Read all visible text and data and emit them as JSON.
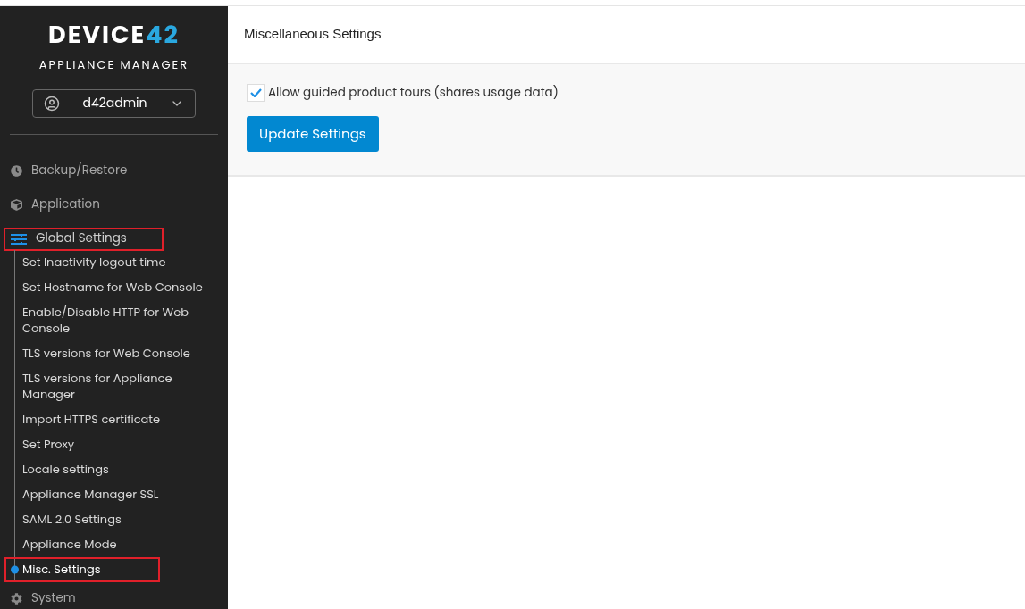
{
  "logo": {
    "name": "DEVICE",
    "number": "42",
    "subtitle": "APPLIANCE MANAGER"
  },
  "user_menu": {
    "label": "d42admin"
  },
  "nav": [
    {
      "label": "Backup/Restore",
      "expanded": false,
      "highlighted": false
    },
    {
      "label": "Application",
      "expanded": false,
      "highlighted": false
    },
    {
      "label": "Global Settings",
      "expanded": true,
      "highlighted": true,
      "children": [
        {
          "label": "Set Inactivity logout time",
          "selected": false,
          "highlighted": false
        },
        {
          "label": "Set Hostname for Web Console",
          "selected": false,
          "highlighted": false
        },
        {
          "label": "Enable/Disable HTTP for Web Console",
          "selected": false,
          "highlighted": false
        },
        {
          "label": "TLS versions for Web Console",
          "selected": false,
          "highlighted": false
        },
        {
          "label": "TLS versions for Appliance Manager",
          "selected": false,
          "highlighted": false
        },
        {
          "label": "Import HTTPS certificate",
          "selected": false,
          "highlighted": false
        },
        {
          "label": "Set Proxy",
          "selected": false,
          "highlighted": false
        },
        {
          "label": "Locale settings",
          "selected": false,
          "highlighted": false
        },
        {
          "label": "Appliance Manager SSL",
          "selected": false,
          "highlighted": false
        },
        {
          "label": "SAML 2.0 Settings",
          "selected": false,
          "highlighted": false
        },
        {
          "label": "Appliance Mode",
          "selected": false,
          "highlighted": false
        },
        {
          "label": "Misc. Settings",
          "selected": true,
          "highlighted": true
        }
      ]
    },
    {
      "label": "System",
      "expanded": false,
      "highlighted": false
    }
  ],
  "page": {
    "title": "Miscellaneous Settings",
    "checkbox": {
      "label": "Allow guided product tours (shares usage data)",
      "checked": true
    },
    "button": "Update Settings"
  }
}
